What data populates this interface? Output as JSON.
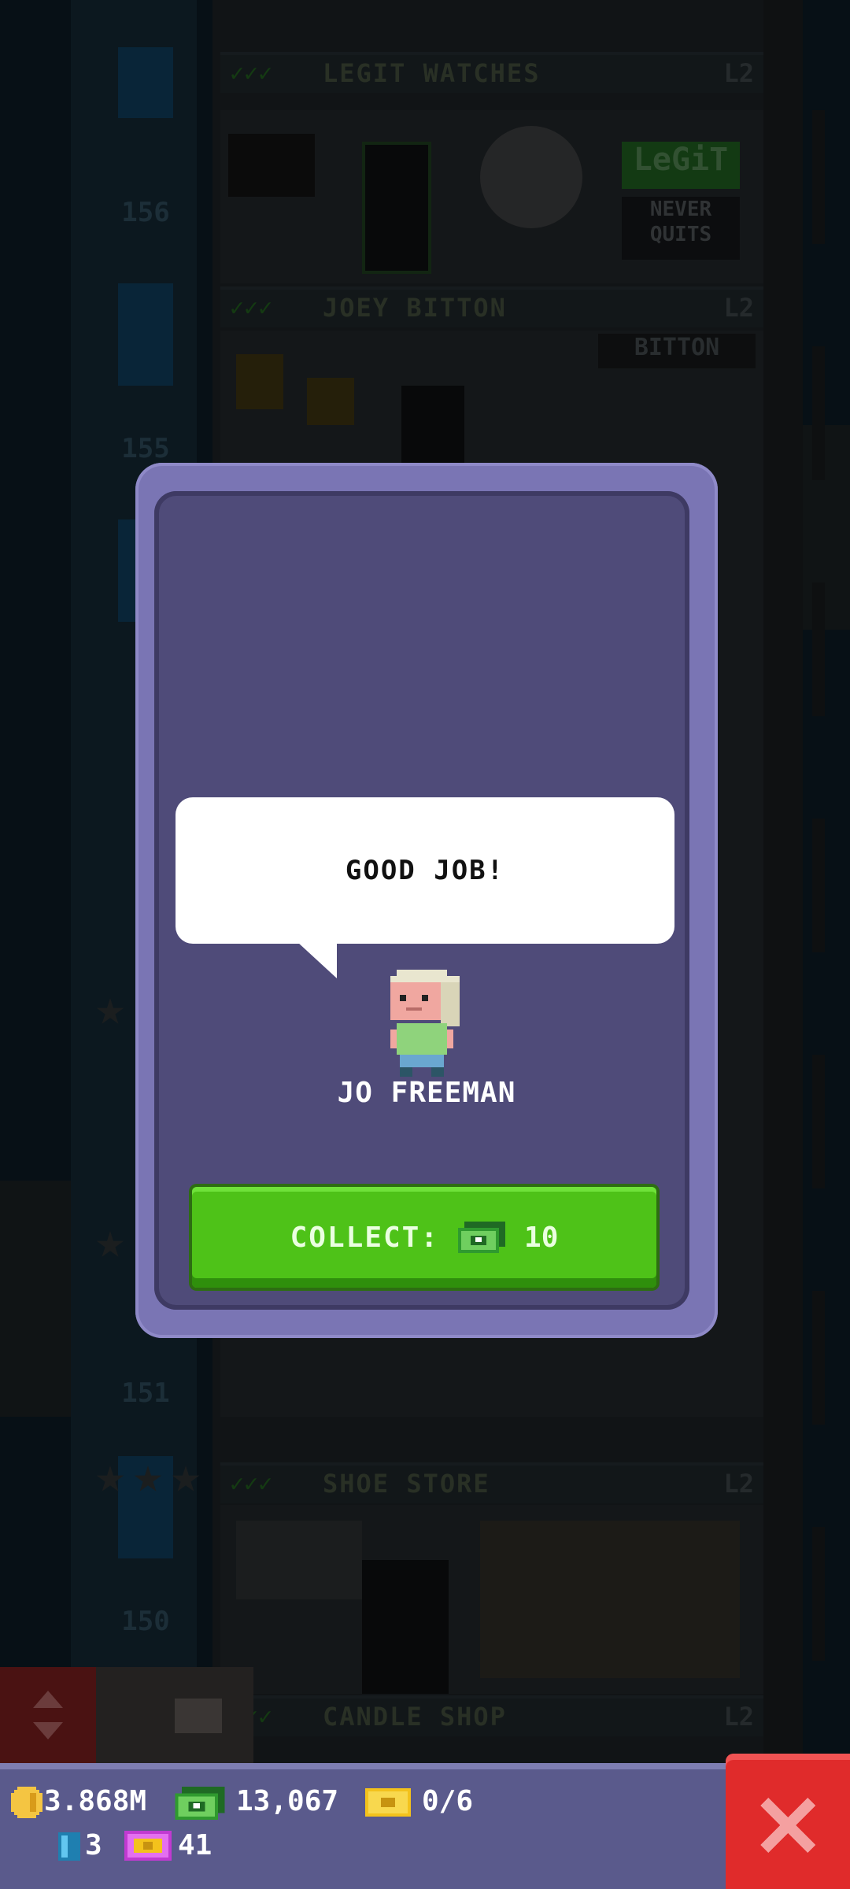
{
  "tower": {
    "floors": [
      {
        "name": "LEGIT WATCHES",
        "level": "L2"
      },
      {
        "name": "JOEY BITTON",
        "level": "L2"
      },
      {
        "name": "SHOE STORE",
        "level": "L2"
      },
      {
        "name": "CANDLE SHOP",
        "level": "L2"
      }
    ],
    "floor_numbers": [
      "156",
      "155",
      "151",
      "150"
    ],
    "signs": {
      "legit": "LeGiT",
      "never_quits": "NEVER QUITS",
      "bitton": "BITTON"
    }
  },
  "dialog": {
    "message": "GOOD JOB!",
    "character_name": "JO FREEMAN",
    "collect_label": "COLLECT:",
    "collect_amount": "10",
    "collect_currency_icon": "tower-bux-icon"
  },
  "hud": {
    "coins": "3.868M",
    "bux": "13,067",
    "tickets": "0/6",
    "elevator_count": "3",
    "vip_count": "41",
    "colors": {
      "coin": "#f4c542",
      "bux": "#2f9a2f",
      "ticket": "#f3c21c",
      "vip": "#c13ad1",
      "close": "#e02b2b"
    }
  }
}
